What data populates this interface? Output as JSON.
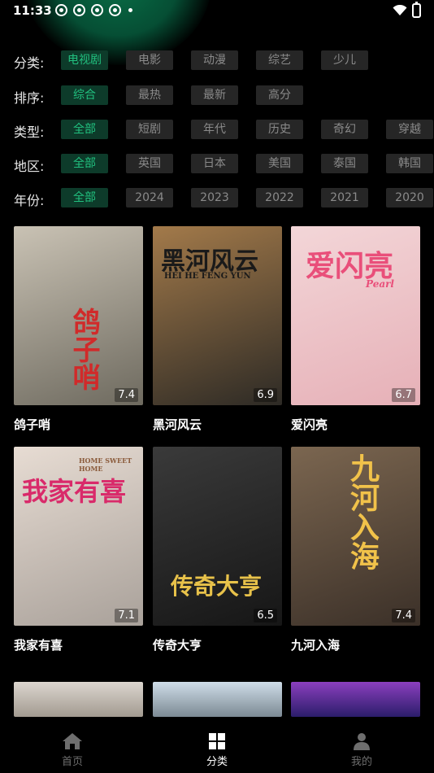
{
  "status_bar": {
    "time": "11:33",
    "notification_icons": [
      "app-icon",
      "app-icon",
      "app-icon",
      "app-icon"
    ]
  },
  "filters": [
    {
      "label": "分类:",
      "options": [
        "电视剧",
        "电影",
        "动漫",
        "综艺",
        "少儿"
      ],
      "selected": 0
    },
    {
      "label": "排序:",
      "options": [
        "综合",
        "最热",
        "最新",
        "高分"
      ],
      "selected": 0
    },
    {
      "label": "类型:",
      "options": [
        "全部",
        "短剧",
        "年代",
        "历史",
        "奇幻",
        "穿越"
      ],
      "selected": 0
    },
    {
      "label": "地区:",
      "options": [
        "全部",
        "英国",
        "日本",
        "美国",
        "泰国",
        "韩国"
      ],
      "selected": 0
    },
    {
      "label": "年份:",
      "options": [
        "全部",
        "2024",
        "2023",
        "2022",
        "2021",
        "2020"
      ],
      "selected": 0
    }
  ],
  "shows": [
    {
      "title": "鸽子哨",
      "score": "7.4",
      "poster_text": "鸽子哨",
      "colors": [
        "#c9c2b4",
        "#6e6a5f"
      ]
    },
    {
      "title": "黑河风云",
      "score": "6.9",
      "poster_text": "黑河风云",
      "poster_sub": "HEI HE FENG YUN",
      "colors": [
        "#a37a4a",
        "#2d2a25"
      ]
    },
    {
      "title": "爱闪亮",
      "score": "6.7",
      "poster_text": "爱闪亮",
      "poster_sub": "Pearl",
      "colors": [
        "#f3d6d8",
        "#e6b0b7"
      ]
    },
    {
      "title": "我家有喜",
      "score": "7.1",
      "poster_text": "我家有喜",
      "poster_sub": "HOME SWEET HOME",
      "colors": [
        "#e7dcd3",
        "#a9a19a"
      ]
    },
    {
      "title": "传奇大亨",
      "score": "6.5",
      "poster_text": "传奇大亨",
      "colors": [
        "#3a3a3a",
        "#161616"
      ]
    },
    {
      "title": "九河入海",
      "score": "7.4",
      "poster_text": "九河入海",
      "colors": [
        "#7b6650",
        "#3b3028"
      ]
    }
  ],
  "next_row_colors": [
    [
      "#dcd6cf",
      "#a29a90"
    ],
    [
      "#cfdde8",
      "#7c8a94"
    ],
    [
      "#8b3fbf",
      "#2b1d6a"
    ]
  ],
  "bottom_nav": [
    {
      "label": "首页",
      "icon": "home-icon",
      "active": false
    },
    {
      "label": "分类",
      "icon": "grid-icon",
      "active": true
    },
    {
      "label": "我的",
      "icon": "person-icon",
      "active": false
    }
  ],
  "accent_color": "#21c07f"
}
